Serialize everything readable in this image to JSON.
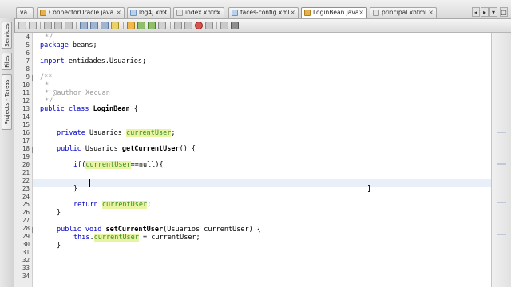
{
  "tabs": [
    {
      "label": "va",
      "icon": "java",
      "active": false
    },
    {
      "label": "ConnectorOracle.java",
      "icon": "java",
      "active": false
    },
    {
      "label": "log4j.xml",
      "icon": "xml",
      "active": false
    },
    {
      "label": "index.xhtml",
      "icon": "xhtml",
      "active": false
    },
    {
      "label": "faces-config.xml",
      "icon": "xml",
      "active": false
    },
    {
      "label": "LoginBean.java",
      "icon": "java",
      "active": true
    },
    {
      "label": "principal.xhtml",
      "icon": "xhtml",
      "active": false
    }
  ],
  "tab_close_glyph": "×",
  "tab_nav": {
    "left": "◂",
    "right": "▸",
    "list": "▾",
    "restore": "□"
  },
  "side_tabs": {
    "services": "Services",
    "files": "Files",
    "projects_tareas": "Projects - Tareas"
  },
  "editor": {
    "lines": [
      {
        "number": "4",
        "text": "*/"
      },
      {
        "number": "5",
        "text": "package beans;"
      },
      {
        "number": "6",
        "text": ""
      },
      {
        "number": "7",
        "text": "import entidades.Usuarios;"
      },
      {
        "number": "8",
        "text": ""
      },
      {
        "number": "9",
        "text": "/**"
      },
      {
        "number": "10",
        "text": "*"
      },
      {
        "number": "11",
        "text": "* @author Xecuan"
      },
      {
        "number": "12",
        "text": "*/"
      },
      {
        "number": "13",
        "text": "public class LoginBean {"
      },
      {
        "number": "14",
        "text": ""
      },
      {
        "number": "15",
        "text": ""
      },
      {
        "number": "16",
        "text": "private Usuarios currentUser;"
      },
      {
        "number": "17",
        "text": ""
      },
      {
        "number": "18",
        "text": "public Usuarios getCurrentUser() {"
      },
      {
        "number": "19",
        "text": ""
      },
      {
        "number": "20",
        "text": "if(currentUser==null){"
      },
      {
        "number": "21",
        "text": ""
      },
      {
        "number": "22",
        "text": ""
      },
      {
        "number": "23",
        "text": "}"
      },
      {
        "number": "24",
        "text": ""
      },
      {
        "number": "25",
        "text": "return currentUser;"
      },
      {
        "number": "26",
        "text": "}"
      },
      {
        "number": "27",
        "text": ""
      },
      {
        "number": "28",
        "text": ""
      },
      {
        "number": "29",
        "text": "public void setCurrentUser(Usuarios currentUser) {"
      },
      {
        "number": "30",
        "text": "this.currentUser = currentUser;"
      },
      {
        "number": "31",
        "text": "}"
      },
      {
        "number": "32",
        "text": ""
      },
      {
        "number": "33",
        "text": ""
      },
      {
        "number": "34",
        "text": ""
      }
    ],
    "tokens": {
      "close_comment": "*/",
      "kw_package": "package",
      "package_name": " beans;",
      "kw_import": "import",
      "import_name": " entidades.Usuarios;",
      "open_javadoc": "/**",
      "javadoc_star": "*",
      "javadoc_author": "* @author Xecuan",
      "kw_public": "public",
      "kw_class": "class",
      "class_name": "LoginBean",
      "open_brace": " {",
      "kw_private": "private",
      "type_usuarios": "Usuarios",
      "field_current_user": "currentUser",
      "semicolon": ";",
      "method_get": "getCurrentUser",
      "empty_params_brace": "() {",
      "kw_if": "if",
      "paren_open": "(",
      "null_check": "==null){",
      "close_brace": "}",
      "kw_return": "return",
      "kw_void": "void",
      "method_set": "setCurrentUser",
      "set_params": "(Usuarios currentUser) {",
      "kw_this": "this",
      "dot": ".",
      "assign_param": " = currentUser;"
    },
    "fold_markers": {
      "collapse": "−",
      "expand": "+"
    }
  },
  "colors": {
    "keyword": "#0000c8",
    "comment": "#9a9a9a",
    "field_highlight_bg": "#e9f4a2",
    "field_highlight_fg": "#3a8a28",
    "right_margin": "#f4a0a0",
    "current_line": "#e9eff8"
  }
}
